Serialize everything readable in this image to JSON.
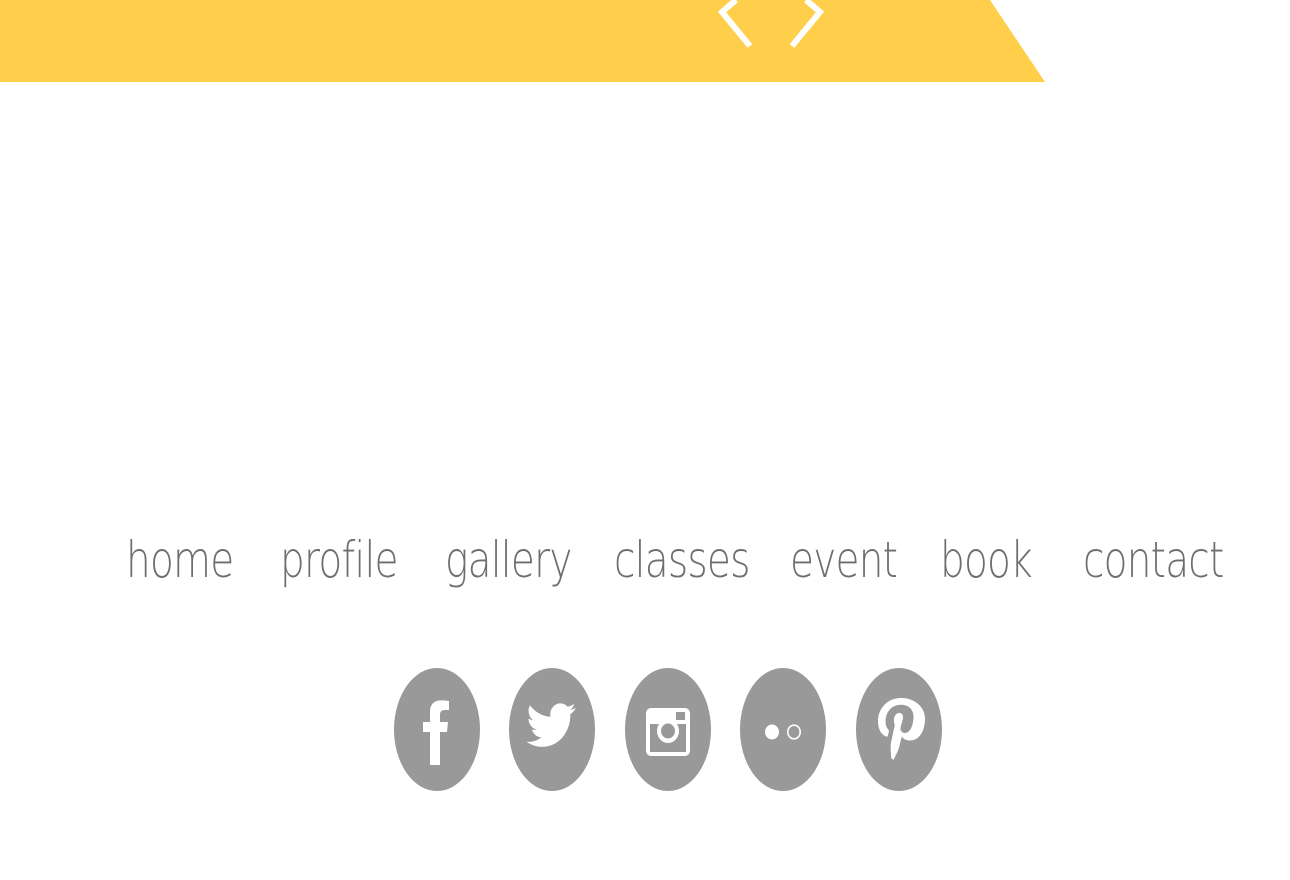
{
  "colors": {
    "banner": "#FFCE4A",
    "nav_text": "#6E6E6E",
    "social_icon": "#999999",
    "background": "#FFFFFF"
  },
  "slider": {
    "prev_icon": "chevron-left-icon",
    "next_icon": "chevron-right-icon"
  },
  "nav": {
    "items": [
      {
        "label": "home"
      },
      {
        "label": "profile"
      },
      {
        "label": "gallery"
      },
      {
        "label": "classes"
      },
      {
        "label": "event"
      },
      {
        "label": "book"
      },
      {
        "label": "contact"
      }
    ]
  },
  "social": {
    "icons": [
      "facebook-icon",
      "twitter-icon",
      "instagram-icon",
      "flickr-icon",
      "pinterest-icon"
    ]
  }
}
